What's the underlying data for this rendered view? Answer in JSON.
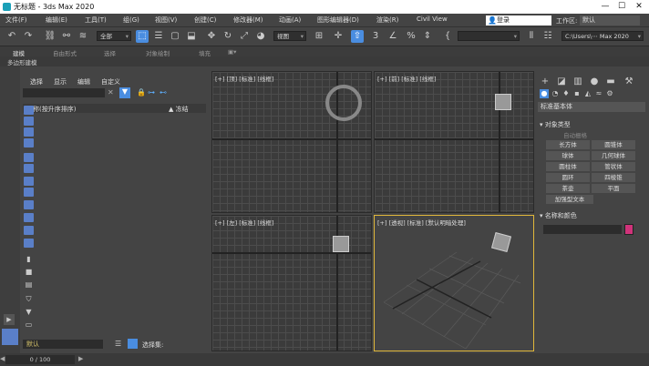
{
  "window": {
    "title": "无标题 - 3ds Max 2020",
    "minimize": "—",
    "maximize": "☐",
    "close": "✕"
  },
  "menu": [
    "文件(F)",
    "编辑(E)",
    "工具(T)",
    "组(G)",
    "视图(V)",
    "创建(C)",
    "修改器(M)",
    "动画(A)",
    "图形编辑器(D)",
    "渲染(R)",
    "Civil View"
  ],
  "account": {
    "signin": "登录",
    "workspace_label": "工作区:",
    "workspace_value": "默认"
  },
  "toolbar": {
    "selection_filter": "全部",
    "ref_coord": "视图",
    "named_sel": "",
    "project_path": "C:\\Users\\⋯ Max 2020"
  },
  "ribbon_tabs": [
    "建模",
    "自由形式",
    "选择",
    "对象绘制",
    "填充"
  ],
  "poly_label": "多边形建模",
  "scene_explorer": {
    "menu": [
      "选择",
      "显示",
      "编辑",
      "自定义"
    ],
    "col_name": "名称(按升序排序)",
    "col_frozen": "▲ 冻结",
    "layer": "默认",
    "selection_set_label": "选择集:"
  },
  "viewports": [
    {
      "label": "[+] [顶] [标准] [线框]"
    },
    {
      "label": "[+] [前] [标准] [线框]"
    },
    {
      "label": "[+] [左] [标准] [线框]"
    },
    {
      "label": "[+] [透视] [标准] [默认明暗处理]"
    }
  ],
  "command_panel": {
    "category": "标准基本体",
    "object_type_title": "对象类型",
    "autogrid": "自动栅格",
    "objects": [
      "长方体",
      "圆锥体",
      "球体",
      "几何球体",
      "圆柱体",
      "管状体",
      "圆环",
      "四棱锥",
      "茶壶",
      "平面",
      "加强型文本"
    ],
    "name_color_title": "名称和颜色",
    "color": "#d0337a"
  },
  "timeline": {
    "frame": "0 / 100"
  }
}
